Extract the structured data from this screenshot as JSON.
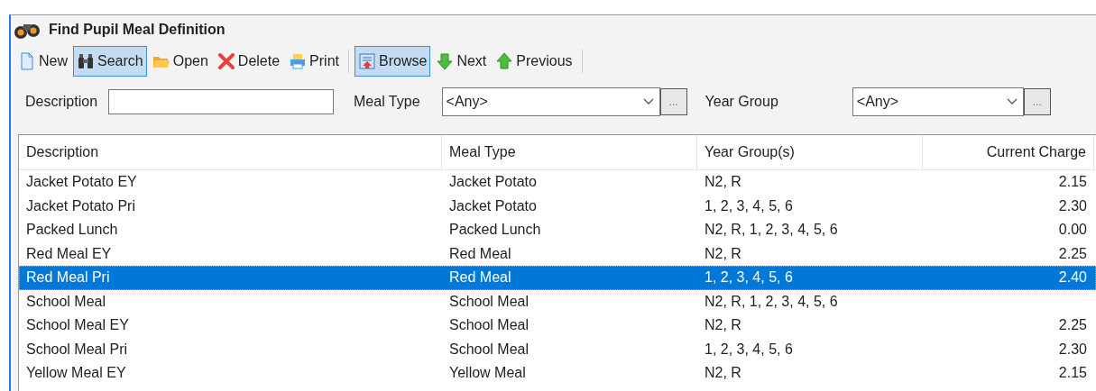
{
  "window": {
    "title": "Find Pupil Meal Definition"
  },
  "toolbar": [
    {
      "kind": "new",
      "label": "New",
      "selected": false
    },
    {
      "kind": "search",
      "label": "Search",
      "selected": true
    },
    {
      "kind": "open",
      "label": "Open",
      "selected": false
    },
    {
      "kind": "delete",
      "label": "Delete",
      "selected": false
    },
    {
      "kind": "print",
      "label": "Print",
      "selected": false
    },
    {
      "kind": "browse",
      "label": "Browse",
      "selected": true
    },
    {
      "kind": "next",
      "label": "Next",
      "selected": false
    },
    {
      "kind": "previous",
      "label": "Previous",
      "selected": false
    }
  ],
  "filters": {
    "description_label": "Description",
    "meal_type_label": "Meal Type",
    "meal_type_value": "<Any>",
    "meal_type_more": "...",
    "year_group_label": "Year Group",
    "year_group_value": "<Any>",
    "year_group_more": "..."
  },
  "table": {
    "columns": [
      "Description",
      "Meal Type",
      "Year Group(s)",
      "Current Charge"
    ],
    "rows": [
      {
        "cells": [
          "Jacket Potato EY",
          "Jacket Potato",
          "N2, R",
          "2.15"
        ],
        "selected": false
      },
      {
        "cells": [
          "Jacket Potato Pri",
          "Jacket Potato",
          "1, 2, 3, 4, 5, 6",
          "2.30"
        ],
        "selected": false
      },
      {
        "cells": [
          "Packed Lunch",
          "Packed Lunch",
          "N2, R, 1, 2, 3, 4, 5, 6",
          "0.00"
        ],
        "selected": false
      },
      {
        "cells": [
          "Red Meal EY",
          "Red Meal",
          "N2, R",
          "2.25"
        ],
        "selected": false
      },
      {
        "cells": [
          "Red Meal Pri",
          "Red Meal",
          "1, 2, 3, 4, 5, 6",
          "2.40"
        ],
        "selected": true
      },
      {
        "cells": [
          "School Meal",
          "School Meal",
          "N2, R, 1, 2, 3, 4, 5, 6"
        ],
        "selected": false
      },
      {
        "cells": [
          "School Meal EY",
          "School Meal",
          "N2, R",
          "2.25"
        ],
        "selected": false
      },
      {
        "cells": [
          "School Meal Pri",
          "School Meal",
          "1, 2, 3, 4, 5, 6",
          "2.30"
        ],
        "selected": false
      },
      {
        "cells": [
          "Yellow Meal EY",
          "Yellow Meal",
          "N2, R",
          "2.15"
        ],
        "selected": false
      }
    ]
  }
}
